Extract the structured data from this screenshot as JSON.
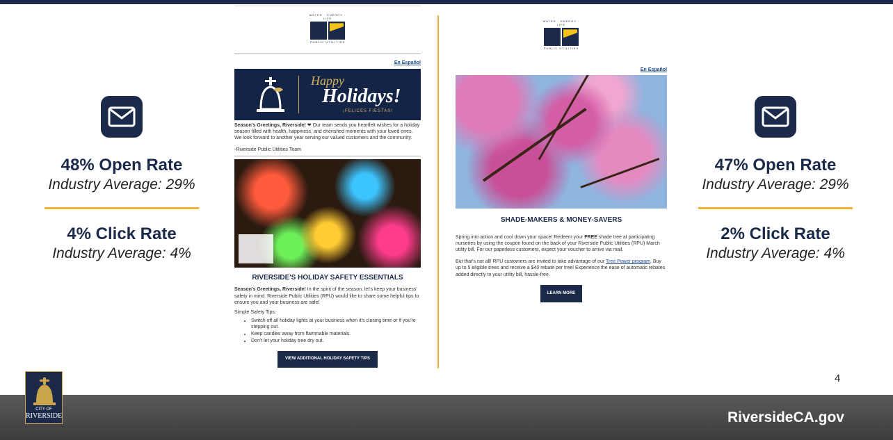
{
  "site_url": "RiversideCA.gov",
  "page_number": "4",
  "logo": {
    "city_of": "CITY OF",
    "city_name": "RIVERSIDE"
  },
  "rpu_logo": {
    "tagline": "WATER · ENERGY · LIFE",
    "subtitle": "PUBLIC UTILITIES"
  },
  "left_stats": {
    "open_rate": "48% Open Rate",
    "open_industry": "Industry Average: 29%",
    "click_rate": "4% Click Rate",
    "click_industry": "Industry Average: 4%"
  },
  "right_stats": {
    "open_rate": "47% Open Rate",
    "open_industry": "Industry Average: 29%",
    "click_rate": "2% Click Rate",
    "click_industry": "Industry Average: 4%"
  },
  "holiday_email": {
    "espanol_link": "En Español",
    "banner_happy": "Happy",
    "banner_holidays": "Holidays!",
    "banner_felices": "¡FELICES FIESTAS!",
    "greeting_lead": "Season's Greetings, Riverside!",
    "greeting_body": " ❤ Our team sends you heartfelt wishes for a holiday season filled with health, happiness, and cherished moments with your loved ones. We look forward to another year serving our valued customers and the community.",
    "signoff": "-Riverside Public Utilities Team",
    "heading": "RIVERSIDE'S HOLIDAY SAFETY ESSENTIALS",
    "body_lead": "Season's Greetings, Riverside!",
    "body_text": " In the spirit of the season, let's keep your business' safety in mind. Riverside Public Utilities (RPU) would like to share some helpful tips to ensure you and your business are safe!",
    "tips_label": "Simple Safety Tips:",
    "tips": [
      "Switch off all holiday lights at your business when it's closing time or if you're stepping out.",
      "Keep candles away from flammable materials.",
      "Don't let your holiday tree dry out."
    ],
    "cta": "VIEW ADDITIONAL HOLIDAY SAFETY TIPS"
  },
  "tree_email": {
    "espanol_link": "En Español",
    "heading": "SHADE-MAKERS & MONEY-SAVERS",
    "para1_a": "Spring into action and cool down your space! Redeem your ",
    "para1_free": "FREE",
    "para1_b": " shade tree at participating nurseries by using the coupon found on the back of your Riverside Public Utilities (RPU) March utility bill. For our paperless customers, expect your voucher to arrive via mail.",
    "para2_a": "But that's not all! RPU customers are invited to take advantage of our ",
    "para2_link": "Tree Power program",
    "para2_b": ". Buy up to 5 eligible trees and receive a $40 rebate per tree! Experience the ease of automatic rebates added directly to your utility bill, hassle-free.",
    "cta": "LEARN MORE"
  }
}
